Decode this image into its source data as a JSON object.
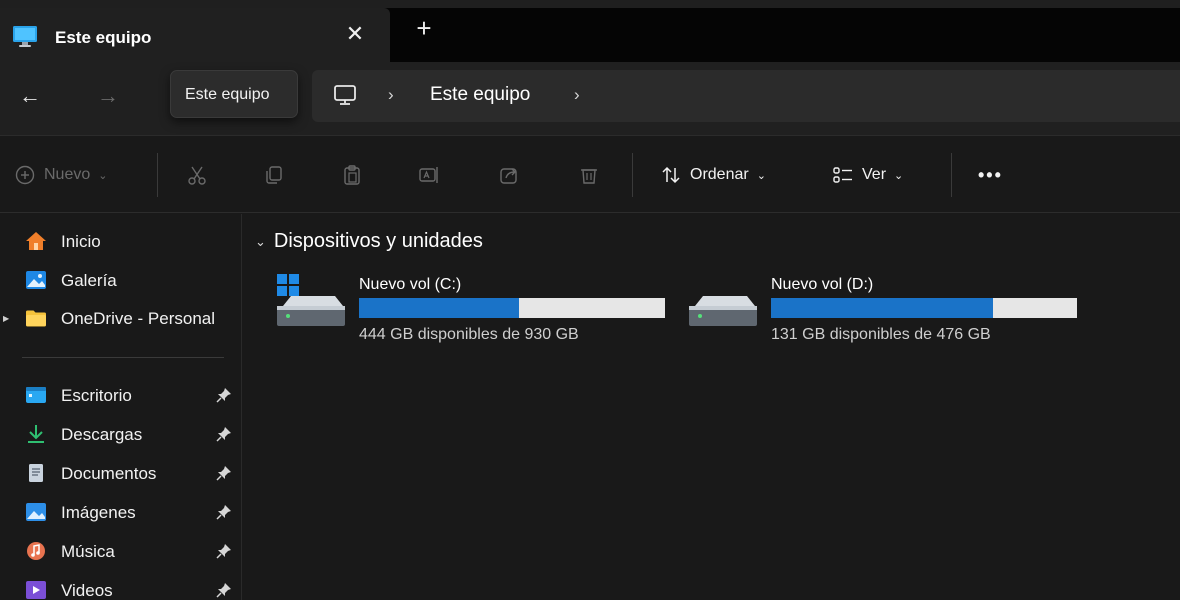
{
  "tab": {
    "title": "Este equipo",
    "close_glyph": "✕",
    "new_glyph": "+"
  },
  "nav": {
    "back_glyph": "←",
    "forward_glyph": "→",
    "tooltip": "Este equipo"
  },
  "address": {
    "icon": "monitor-icon",
    "segment": "Este equipo",
    "chevron": "›"
  },
  "toolbar": {
    "new_label": "Nuevo",
    "sort_label": "Ordenar",
    "view_label": "Ver",
    "more_label": "•••",
    "chevron": "⌄",
    "icons": [
      "add-circle-icon",
      "cut-icon",
      "copy-icon",
      "paste-icon",
      "rename-icon",
      "share-icon",
      "delete-icon",
      "sort-icon",
      "view-icon",
      "more-icon"
    ]
  },
  "sidebar": {
    "items": [
      {
        "label": "Inicio",
        "icon": "home-icon",
        "pinned": false
      },
      {
        "label": "Galería",
        "icon": "gallery-icon",
        "pinned": false
      },
      {
        "label": "OneDrive - Personal",
        "icon": "folder-icon",
        "pinned": false,
        "expandable": true
      },
      {
        "label": "Escritorio",
        "icon": "desktop-icon",
        "pinned": true
      },
      {
        "label": "Descargas",
        "icon": "download-icon",
        "pinned": true
      },
      {
        "label": "Documentos",
        "icon": "document-icon",
        "pinned": true
      },
      {
        "label": "Imágenes",
        "icon": "pictures-icon",
        "pinned": true
      },
      {
        "label": "Música",
        "icon": "music-icon",
        "pinned": true
      },
      {
        "label": "Videos",
        "icon": "videos-icon",
        "pinned": true
      }
    ]
  },
  "main": {
    "group_title": "Dispositivos y unidades",
    "group_chevron": "⌄",
    "drives": [
      {
        "name": "Nuevo vol (C:)",
        "info": "444 GB disponibles de 930 GB",
        "used_fraction": 0.523,
        "icon": "system-drive-icon"
      },
      {
        "name": "Nuevo vol (D:)",
        "info": "131 GB disponibles de 476 GB",
        "used_fraction": 0.725,
        "icon": "drive-icon"
      }
    ]
  },
  "colors": {
    "accent": "#1a73c8",
    "bar_empty": "#e6e6e6",
    "background": "#191919",
    "folder": "#f5c23b"
  }
}
